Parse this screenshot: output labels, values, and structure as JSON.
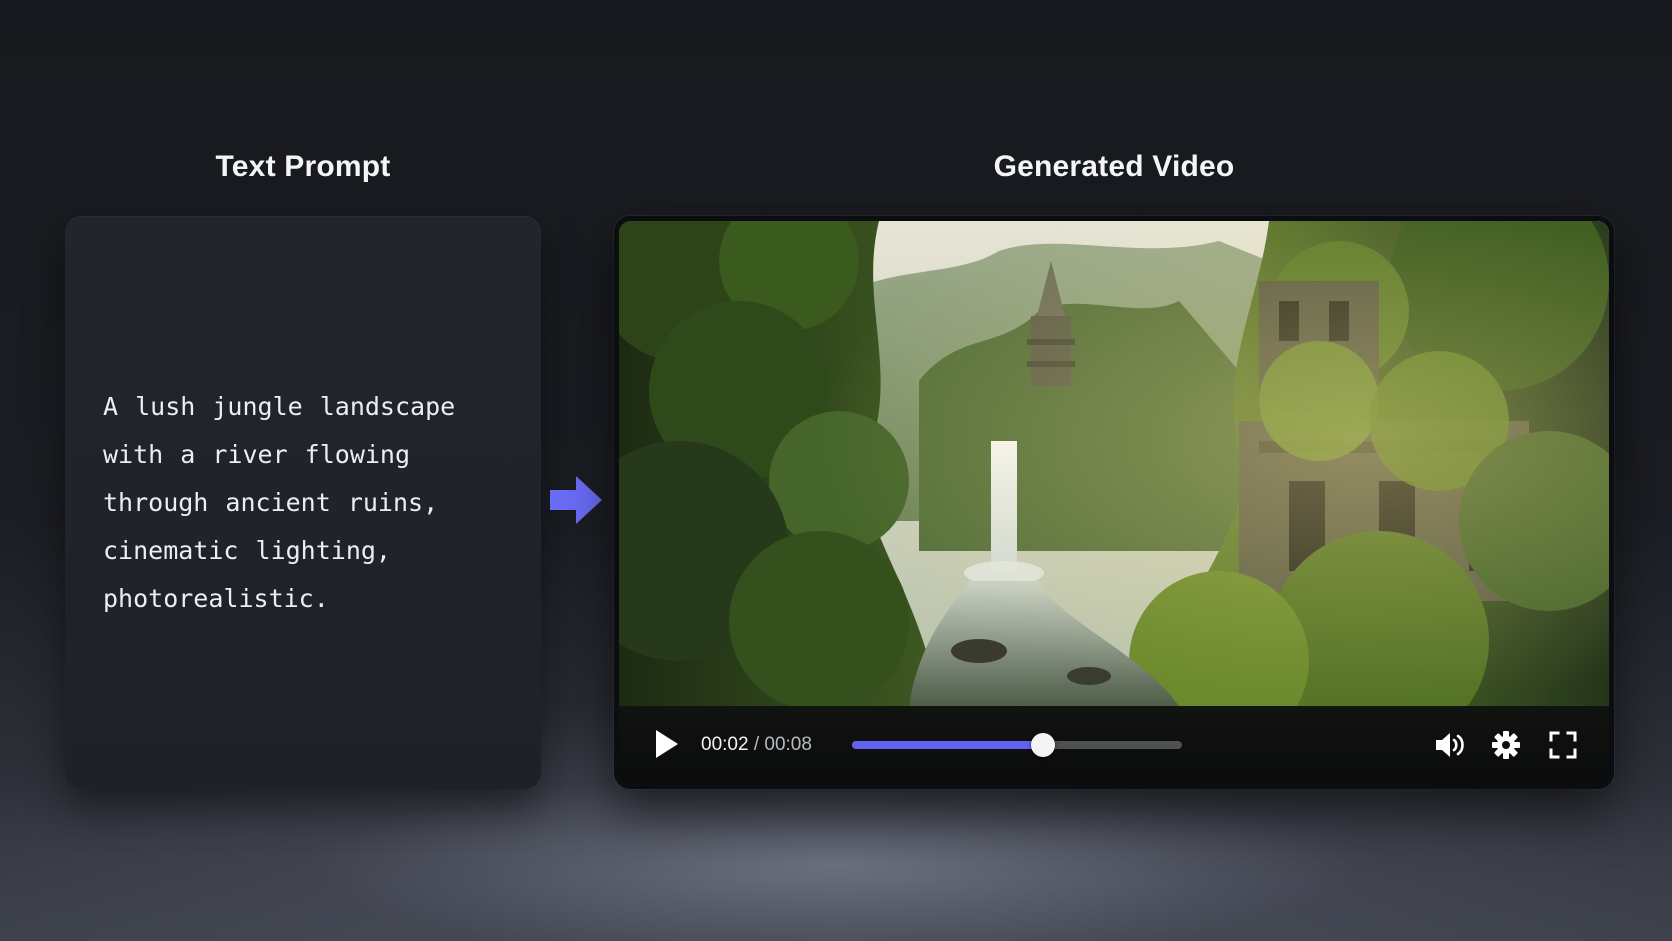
{
  "headings": {
    "prompt": "Text Prompt",
    "video": "Generated Video"
  },
  "prompt": {
    "text": "A lush jungle landscape with a river flowing through ancient ruins, cinematic lighting, photorealistic."
  },
  "player": {
    "current_time": "00:02",
    "separator": " / ",
    "total_time": "00:08",
    "progress_fraction": 0.58,
    "accent_color": "#6262f0",
    "icons": {
      "play": "play-icon",
      "volume": "volume-icon",
      "settings": "gear-icon",
      "fullscreen": "fullscreen-icon"
    }
  },
  "colors": {
    "arrow": "#6a6cf5",
    "background": "#1b1d23",
    "card": "#22242b"
  }
}
